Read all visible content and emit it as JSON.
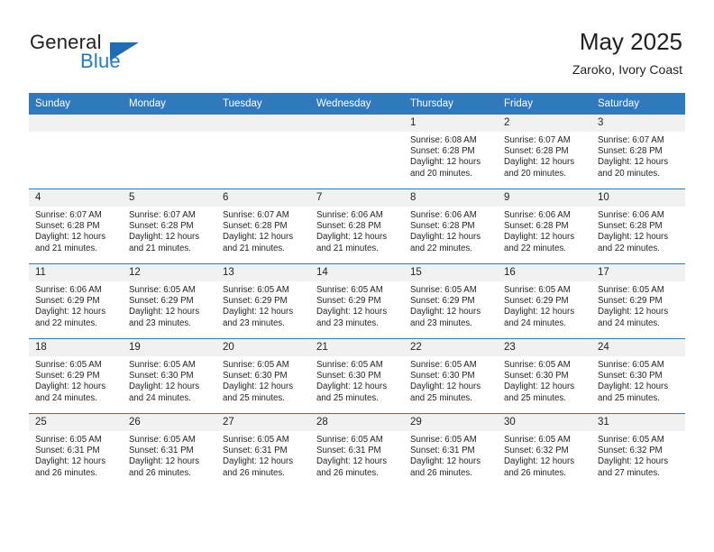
{
  "brand": {
    "name_part1": "General",
    "name_part2": "Blue",
    "logo_icon": "triangle-flag-icon"
  },
  "header": {
    "title": "May 2025",
    "subtitle": "Zaroko, Ivory Coast"
  },
  "colors": {
    "header_blue": "#3079bd",
    "brand_blue": "#1f7ac4",
    "daynum_band": "#f1f1f1",
    "text": "#231f20"
  },
  "weekday_headers": [
    "Sunday",
    "Monday",
    "Tuesday",
    "Wednesday",
    "Thursday",
    "Friday",
    "Saturday"
  ],
  "labels": {
    "sunrise_prefix": "Sunrise:",
    "sunset_prefix": "Sunset:",
    "daylight_prefix": "Daylight:"
  },
  "weeks": [
    [
      {
        "blank": true,
        "day": ""
      },
      {
        "blank": true,
        "day": ""
      },
      {
        "blank": true,
        "day": ""
      },
      {
        "blank": true,
        "day": ""
      },
      {
        "blank": false,
        "day": "1",
        "sunrise": "Sunrise: 6:08 AM",
        "sunset": "Sunset: 6:28 PM",
        "daylight1": "Daylight: 12 hours",
        "daylight2": "and 20 minutes."
      },
      {
        "blank": false,
        "day": "2",
        "sunrise": "Sunrise: 6:07 AM",
        "sunset": "Sunset: 6:28 PM",
        "daylight1": "Daylight: 12 hours",
        "daylight2": "and 20 minutes."
      },
      {
        "blank": false,
        "day": "3",
        "sunrise": "Sunrise: 6:07 AM",
        "sunset": "Sunset: 6:28 PM",
        "daylight1": "Daylight: 12 hours",
        "daylight2": "and 20 minutes."
      }
    ],
    [
      {
        "blank": false,
        "day": "4",
        "sunrise": "Sunrise: 6:07 AM",
        "sunset": "Sunset: 6:28 PM",
        "daylight1": "Daylight: 12 hours",
        "daylight2": "and 21 minutes."
      },
      {
        "blank": false,
        "day": "5",
        "sunrise": "Sunrise: 6:07 AM",
        "sunset": "Sunset: 6:28 PM",
        "daylight1": "Daylight: 12 hours",
        "daylight2": "and 21 minutes."
      },
      {
        "blank": false,
        "day": "6",
        "sunrise": "Sunrise: 6:07 AM",
        "sunset": "Sunset: 6:28 PM",
        "daylight1": "Daylight: 12 hours",
        "daylight2": "and 21 minutes."
      },
      {
        "blank": false,
        "day": "7",
        "sunrise": "Sunrise: 6:06 AM",
        "sunset": "Sunset: 6:28 PM",
        "daylight1": "Daylight: 12 hours",
        "daylight2": "and 21 minutes."
      },
      {
        "blank": false,
        "day": "8",
        "sunrise": "Sunrise: 6:06 AM",
        "sunset": "Sunset: 6:28 PM",
        "daylight1": "Daylight: 12 hours",
        "daylight2": "and 22 minutes."
      },
      {
        "blank": false,
        "day": "9",
        "sunrise": "Sunrise: 6:06 AM",
        "sunset": "Sunset: 6:28 PM",
        "daylight1": "Daylight: 12 hours",
        "daylight2": "and 22 minutes."
      },
      {
        "blank": false,
        "day": "10",
        "sunrise": "Sunrise: 6:06 AM",
        "sunset": "Sunset: 6:28 PM",
        "daylight1": "Daylight: 12 hours",
        "daylight2": "and 22 minutes."
      }
    ],
    [
      {
        "blank": false,
        "day": "11",
        "sunrise": "Sunrise: 6:06 AM",
        "sunset": "Sunset: 6:29 PM",
        "daylight1": "Daylight: 12 hours",
        "daylight2": "and 22 minutes."
      },
      {
        "blank": false,
        "day": "12",
        "sunrise": "Sunrise: 6:05 AM",
        "sunset": "Sunset: 6:29 PM",
        "daylight1": "Daylight: 12 hours",
        "daylight2": "and 23 minutes."
      },
      {
        "blank": false,
        "day": "13",
        "sunrise": "Sunrise: 6:05 AM",
        "sunset": "Sunset: 6:29 PM",
        "daylight1": "Daylight: 12 hours",
        "daylight2": "and 23 minutes."
      },
      {
        "blank": false,
        "day": "14",
        "sunrise": "Sunrise: 6:05 AM",
        "sunset": "Sunset: 6:29 PM",
        "daylight1": "Daylight: 12 hours",
        "daylight2": "and 23 minutes."
      },
      {
        "blank": false,
        "day": "15",
        "sunrise": "Sunrise: 6:05 AM",
        "sunset": "Sunset: 6:29 PM",
        "daylight1": "Daylight: 12 hours",
        "daylight2": "and 23 minutes."
      },
      {
        "blank": false,
        "day": "16",
        "sunrise": "Sunrise: 6:05 AM",
        "sunset": "Sunset: 6:29 PM",
        "daylight1": "Daylight: 12 hours",
        "daylight2": "and 24 minutes."
      },
      {
        "blank": false,
        "day": "17",
        "sunrise": "Sunrise: 6:05 AM",
        "sunset": "Sunset: 6:29 PM",
        "daylight1": "Daylight: 12 hours",
        "daylight2": "and 24 minutes."
      }
    ],
    [
      {
        "blank": false,
        "day": "18",
        "sunrise": "Sunrise: 6:05 AM",
        "sunset": "Sunset: 6:29 PM",
        "daylight1": "Daylight: 12 hours",
        "daylight2": "and 24 minutes."
      },
      {
        "blank": false,
        "day": "19",
        "sunrise": "Sunrise: 6:05 AM",
        "sunset": "Sunset: 6:30 PM",
        "daylight1": "Daylight: 12 hours",
        "daylight2": "and 24 minutes."
      },
      {
        "blank": false,
        "day": "20",
        "sunrise": "Sunrise: 6:05 AM",
        "sunset": "Sunset: 6:30 PM",
        "daylight1": "Daylight: 12 hours",
        "daylight2": "and 25 minutes."
      },
      {
        "blank": false,
        "day": "21",
        "sunrise": "Sunrise: 6:05 AM",
        "sunset": "Sunset: 6:30 PM",
        "daylight1": "Daylight: 12 hours",
        "daylight2": "and 25 minutes."
      },
      {
        "blank": false,
        "day": "22",
        "sunrise": "Sunrise: 6:05 AM",
        "sunset": "Sunset: 6:30 PM",
        "daylight1": "Daylight: 12 hours",
        "daylight2": "and 25 minutes."
      },
      {
        "blank": false,
        "day": "23",
        "sunrise": "Sunrise: 6:05 AM",
        "sunset": "Sunset: 6:30 PM",
        "daylight1": "Daylight: 12 hours",
        "daylight2": "and 25 minutes."
      },
      {
        "blank": false,
        "day": "24",
        "sunrise": "Sunrise: 6:05 AM",
        "sunset": "Sunset: 6:30 PM",
        "daylight1": "Daylight: 12 hours",
        "daylight2": "and 25 minutes."
      }
    ],
    [
      {
        "blank": false,
        "day": "25",
        "sunrise": "Sunrise: 6:05 AM",
        "sunset": "Sunset: 6:31 PM",
        "daylight1": "Daylight: 12 hours",
        "daylight2": "and 26 minutes."
      },
      {
        "blank": false,
        "day": "26",
        "sunrise": "Sunrise: 6:05 AM",
        "sunset": "Sunset: 6:31 PM",
        "daylight1": "Daylight: 12 hours",
        "daylight2": "and 26 minutes."
      },
      {
        "blank": false,
        "day": "27",
        "sunrise": "Sunrise: 6:05 AM",
        "sunset": "Sunset: 6:31 PM",
        "daylight1": "Daylight: 12 hours",
        "daylight2": "and 26 minutes."
      },
      {
        "blank": false,
        "day": "28",
        "sunrise": "Sunrise: 6:05 AM",
        "sunset": "Sunset: 6:31 PM",
        "daylight1": "Daylight: 12 hours",
        "daylight2": "and 26 minutes."
      },
      {
        "blank": false,
        "day": "29",
        "sunrise": "Sunrise: 6:05 AM",
        "sunset": "Sunset: 6:31 PM",
        "daylight1": "Daylight: 12 hours",
        "daylight2": "and 26 minutes."
      },
      {
        "blank": false,
        "day": "30",
        "sunrise": "Sunrise: 6:05 AM",
        "sunset": "Sunset: 6:32 PM",
        "daylight1": "Daylight: 12 hours",
        "daylight2": "and 26 minutes."
      },
      {
        "blank": false,
        "day": "31",
        "sunrise": "Sunrise: 6:05 AM",
        "sunset": "Sunset: 6:32 PM",
        "daylight1": "Daylight: 12 hours",
        "daylight2": "and 27 minutes."
      }
    ]
  ]
}
